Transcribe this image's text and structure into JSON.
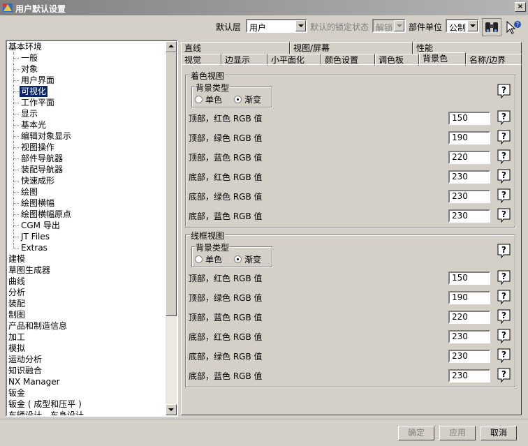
{
  "window": {
    "title": "用户默认设置",
    "close_label": "×"
  },
  "toolbar": {
    "level_label": "默认层",
    "level_value": "用户",
    "lock_label": "默认的锁定状态",
    "lock_value": "解锁",
    "unit_label": "部件单位",
    "unit_value": "公制"
  },
  "tree": {
    "items": [
      "基本环境",
      "一般",
      "对象",
      "用户界面",
      "可视化",
      "工作平面",
      "显示",
      "基本光",
      "编辑对象显示",
      "视图操作",
      "部件导航器",
      "装配导航器",
      "快速成形",
      "绘图",
      "绘图横幅",
      "绘图横幅原点",
      "CGM 导出",
      "JT Files",
      "Extras",
      "建模",
      "草图生成器",
      "曲线",
      "分析",
      "装配",
      "制图",
      "产品和制造信息",
      "加工",
      "模拟",
      "运动分析",
      "知识融合",
      "NX Manager",
      "钣金",
      "钣金 ( 成型和压平 )",
      "车辆设计 - 车身设计"
    ],
    "selected": "可视化"
  },
  "tabs": {
    "row1": [
      "直线",
      "视图/屏幕",
      "性能"
    ],
    "row2": [
      "视觉",
      "边显示",
      "小平面化",
      "颜色设置",
      "调色板",
      "背景色",
      "名称/边界"
    ],
    "active": "背景色"
  },
  "shaded": {
    "title": "着色视图",
    "bg_type_label": "背景类型",
    "opt_single": "单色",
    "opt_gradient": "渐变",
    "rows": [
      {
        "label": "顶部，红色 RGB 值",
        "value": "150"
      },
      {
        "label": "顶部，绿色 RGB 值",
        "value": "190"
      },
      {
        "label": "顶部，蓝色 RGB 值",
        "value": "220"
      },
      {
        "label": "底部，红色 RGB 值",
        "value": "230"
      },
      {
        "label": "底部，绿色 RGB 值",
        "value": "230"
      },
      {
        "label": "底部，蓝色 RGB 值",
        "value": "230"
      }
    ]
  },
  "wireframe": {
    "title": "线框视图",
    "bg_type_label": "背景类型",
    "opt_single": "单色",
    "opt_gradient": "渐变",
    "rows": [
      {
        "label": "顶部，红色 RGB 值",
        "value": "150"
      },
      {
        "label": "顶部，绿色 RGB 值",
        "value": "190"
      },
      {
        "label": "顶部，蓝色 RGB 值",
        "value": "220"
      },
      {
        "label": "底部，红色 RGB 值",
        "value": "230"
      },
      {
        "label": "底部，绿色 RGB 值",
        "value": "230"
      },
      {
        "label": "底部，蓝色 RGB 值",
        "value": "230"
      }
    ]
  },
  "buttons": {
    "ok": "确定",
    "apply": "应用",
    "cancel": "取消"
  }
}
